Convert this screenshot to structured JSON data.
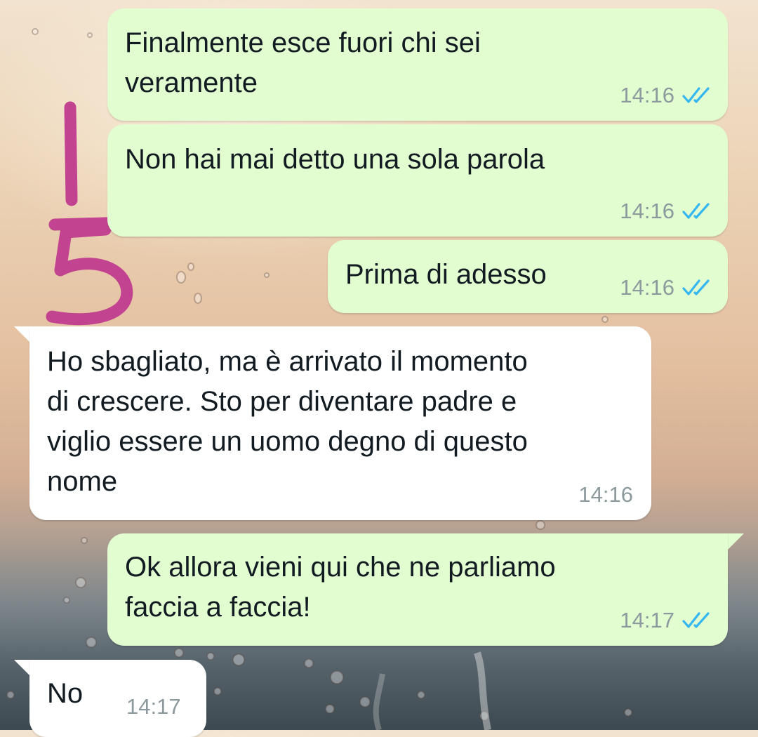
{
  "chat": {
    "messages": [
      {
        "direction": "outgoing",
        "text": "Finalmente esce fuori chi sei\nveramente",
        "time": "14:16",
        "status": "read",
        "status_icon": "double-check-icon"
      },
      {
        "direction": "outgoing",
        "text": "Non hai mai detto una sola parola",
        "time": "14:16",
        "status": "read",
        "status_icon": "double-check-icon"
      },
      {
        "direction": "outgoing",
        "text": "Prima di adesso",
        "time": "14:16",
        "status": "read",
        "status_icon": "double-check-icon"
      },
      {
        "direction": "incoming",
        "text": "Ho sbagliato, ma è arrivato il momento\ndi crescere. Sto per diventare padre e\nviglio essere un uomo degno di questo\nnome",
        "time": "14:16"
      },
      {
        "direction": "outgoing",
        "text": "Ok allora vieni qui che ne parliamo\nfaccia a faccia!",
        "time": "14:17",
        "status": "read",
        "status_icon": "double-check-icon"
      },
      {
        "direction": "incoming",
        "text": "No",
        "time": "14:17"
      }
    ]
  },
  "annotation": {
    "text": "1/5",
    "color": "#c2438f"
  },
  "colors": {
    "outgoing_bubble": "#e2fdd0",
    "incoming_bubble": "#ffffff",
    "read_tick": "#34b7f1",
    "timestamp": "#8c9a9e"
  }
}
